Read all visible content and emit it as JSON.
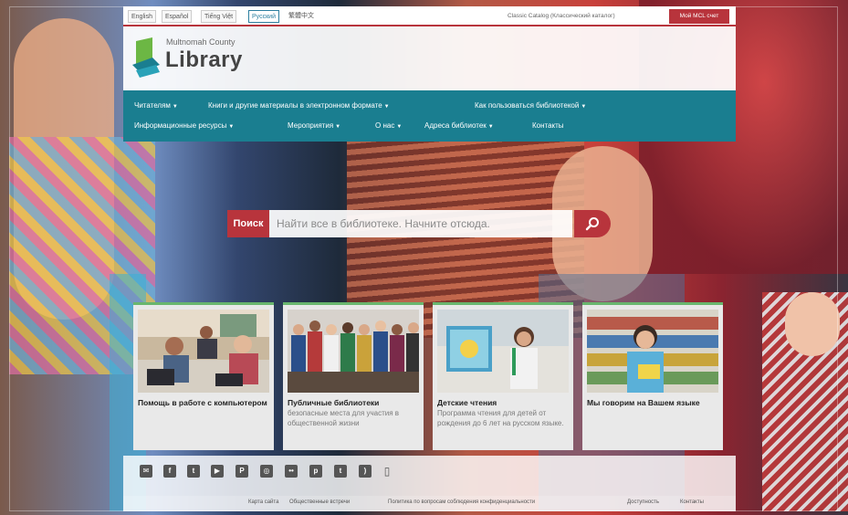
{
  "languages": [
    {
      "label": "English"
    },
    {
      "label": "Español"
    },
    {
      "label": "Tiếng Việt"
    },
    {
      "label": "Русский",
      "active": true
    },
    {
      "label": "繁體中文"
    }
  ],
  "classic_catalog_link": "Classic Catalog (Классический каталог)",
  "my_account_button": "Мой MCL счет",
  "logo": {
    "county": "Multnomah County",
    "name": "Library"
  },
  "nav": {
    "row1": [
      {
        "label": "Читателям",
        "dropdown": true
      },
      {
        "label": "Книги и другие материалы в электронном формате",
        "dropdown": true
      },
      {
        "label": "Как пользоваться библиотекой",
        "dropdown": true
      }
    ],
    "row2": [
      {
        "label": "Информационные ресурсы",
        "dropdown": true
      },
      {
        "label": "Мероприятия",
        "dropdown": true
      },
      {
        "label": "О нас",
        "dropdown": true
      },
      {
        "label": "Адреса библиотек",
        "dropdown": true
      },
      {
        "label": "Контакты",
        "dropdown": false
      }
    ]
  },
  "search": {
    "label": "Поиск",
    "placeholder": "Найти все в библиотеке. Начните отсюда."
  },
  "cards": [
    {
      "title": "Помощь в работе с компьютером",
      "desc": ""
    },
    {
      "title": "Публичные библиотеки",
      "desc": "безопасные места для участия в общественной жизни"
    },
    {
      "title": "Детские чтения",
      "desc": "Программа чтения для детей от рождения до 6 лет на русском языке."
    },
    {
      "title": "Мы говорим на Вашем языке",
      "desc": ""
    }
  ],
  "social_icons": [
    {
      "name": "email-icon",
      "glyph": "✉"
    },
    {
      "name": "facebook-icon",
      "glyph": "f"
    },
    {
      "name": "twitter-icon",
      "glyph": "t"
    },
    {
      "name": "youtube-icon",
      "glyph": "▶"
    },
    {
      "name": "pinterest-icon",
      "glyph": "P"
    },
    {
      "name": "instagram-icon",
      "glyph": "◎"
    },
    {
      "name": "flickr-icon",
      "glyph": "••"
    },
    {
      "name": "pinterest-alt-icon",
      "glyph": "p"
    },
    {
      "name": "tumblr-icon",
      "glyph": "t"
    },
    {
      "name": "rss-icon",
      "glyph": ")"
    },
    {
      "name": "mobile-icon",
      "glyph": "▯"
    }
  ],
  "footer_links": [
    "Карта сайта",
    "Общественные встречи",
    "Политика по вопросам соблюдения конфиденциальности",
    "Доступность",
    "Контакты"
  ],
  "colors": {
    "accent_red": "#b8343c",
    "nav_teal": "#1a7e90",
    "card_green": "#69b66e"
  }
}
